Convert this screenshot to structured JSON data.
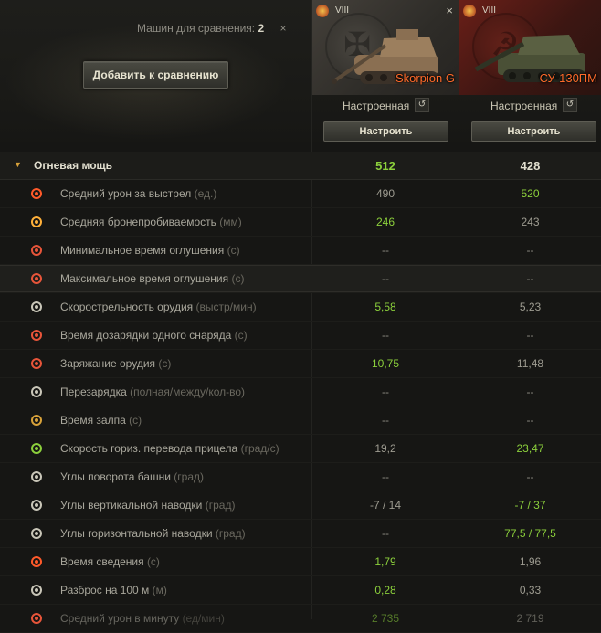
{
  "header": {
    "compare_label": "Машин для сравнения:",
    "compare_count": "2",
    "close_all": "×",
    "add_button": "Добавить к сравнению"
  },
  "vehicles": [
    {
      "tier": "VIII",
      "name": "Skorpion G",
      "config_label": "Настроенная",
      "configure_button": "Настроить",
      "nation_icon": "germany-emblem-icon",
      "close": "×"
    },
    {
      "tier": "VIII",
      "name": "СУ-130ПМ",
      "config_label": "Настроенная",
      "configure_button": "Настроить",
      "nation_icon": "ussr-emblem-icon",
      "close": "×"
    }
  ],
  "section": {
    "title": "Огневая мощь",
    "v1": "512",
    "v2": "428"
  },
  "rows": [
    {
      "label": "Средний урон за выстрел",
      "unit": "(ед.)",
      "v1": "490",
      "v2": "520",
      "best": 2,
      "icon": "damage-icon"
    },
    {
      "label": "Средняя бронепробиваемость",
      "unit": "(мм)",
      "v1": "246",
      "v2": "243",
      "best": 1,
      "icon": "penetration-icon"
    },
    {
      "label": "Минимальное время оглушения",
      "unit": "(с)",
      "v1": "--",
      "v2": "--",
      "best": 0,
      "icon": "stun-min-icon"
    },
    {
      "label": "Максимальное время оглушения",
      "unit": "(с)",
      "v1": "--",
      "v2": "--",
      "best": 0,
      "icon": "stun-max-icon"
    },
    {
      "label": "Скорострельность орудия",
      "unit": "(выстр/мин)",
      "v1": "5,58",
      "v2": "5,23",
      "best": 1,
      "icon": "rate-of-fire-icon"
    },
    {
      "label": "Время дозарядки одного снаряда",
      "unit": "(с)",
      "v1": "--",
      "v2": "--",
      "best": 0,
      "icon": "intra-clip-reload-icon"
    },
    {
      "label": "Заряжание орудия",
      "unit": "(с)",
      "v1": "10,75",
      "v2": "11,48",
      "best": 1,
      "icon": "reload-icon"
    },
    {
      "label": "Перезарядка",
      "unit": "(полная/между/кол-во)",
      "v1": "--",
      "v2": "--",
      "best": 0,
      "icon": "clip-reload-icon"
    },
    {
      "label": "Время залпа",
      "unit": "(с)",
      "v1": "--",
      "v2": "--",
      "best": 0,
      "icon": "salvo-icon"
    },
    {
      "label": "Скорость гориз. перевода прицела",
      "unit": "(град/с)",
      "v1": "19,2",
      "v2": "23,47",
      "best": 2,
      "icon": "traverse-speed-icon"
    },
    {
      "label": "Углы поворота башни",
      "unit": "(град)",
      "v1": "--",
      "v2": "--",
      "best": 0,
      "icon": "turret-angles-icon"
    },
    {
      "label": "Углы вертикальной наводки",
      "unit": "(град)",
      "v1": "-7 / 14",
      "v2": "-7 / 37",
      "best": 2,
      "icon": "elevation-angles-icon"
    },
    {
      "label": "Углы горизонтальной наводки",
      "unit": "(град)",
      "v1": "--",
      "v2": "77,5 / 77,5",
      "best": 2,
      "icon": "horizontal-angles-icon"
    },
    {
      "label": "Время сведения",
      "unit": "(с)",
      "v1": "1,79",
      "v2": "1,96",
      "best": 1,
      "icon": "aim-time-icon"
    },
    {
      "label": "Разброс на 100 м",
      "unit": "(м)",
      "v1": "0,28",
      "v2": "0,33",
      "best": 1,
      "icon": "dispersion-icon"
    },
    {
      "label": "Средний урон в минуту",
      "unit": "(ед/мин)",
      "v1": "2 735",
      "v2": "2 719",
      "best": 1,
      "icon": "damage-per-minute-icon"
    }
  ],
  "colors": {
    "best": "#8cd03c",
    "accent": "#ff6a2a",
    "section_arrow": "#d8a23a"
  }
}
